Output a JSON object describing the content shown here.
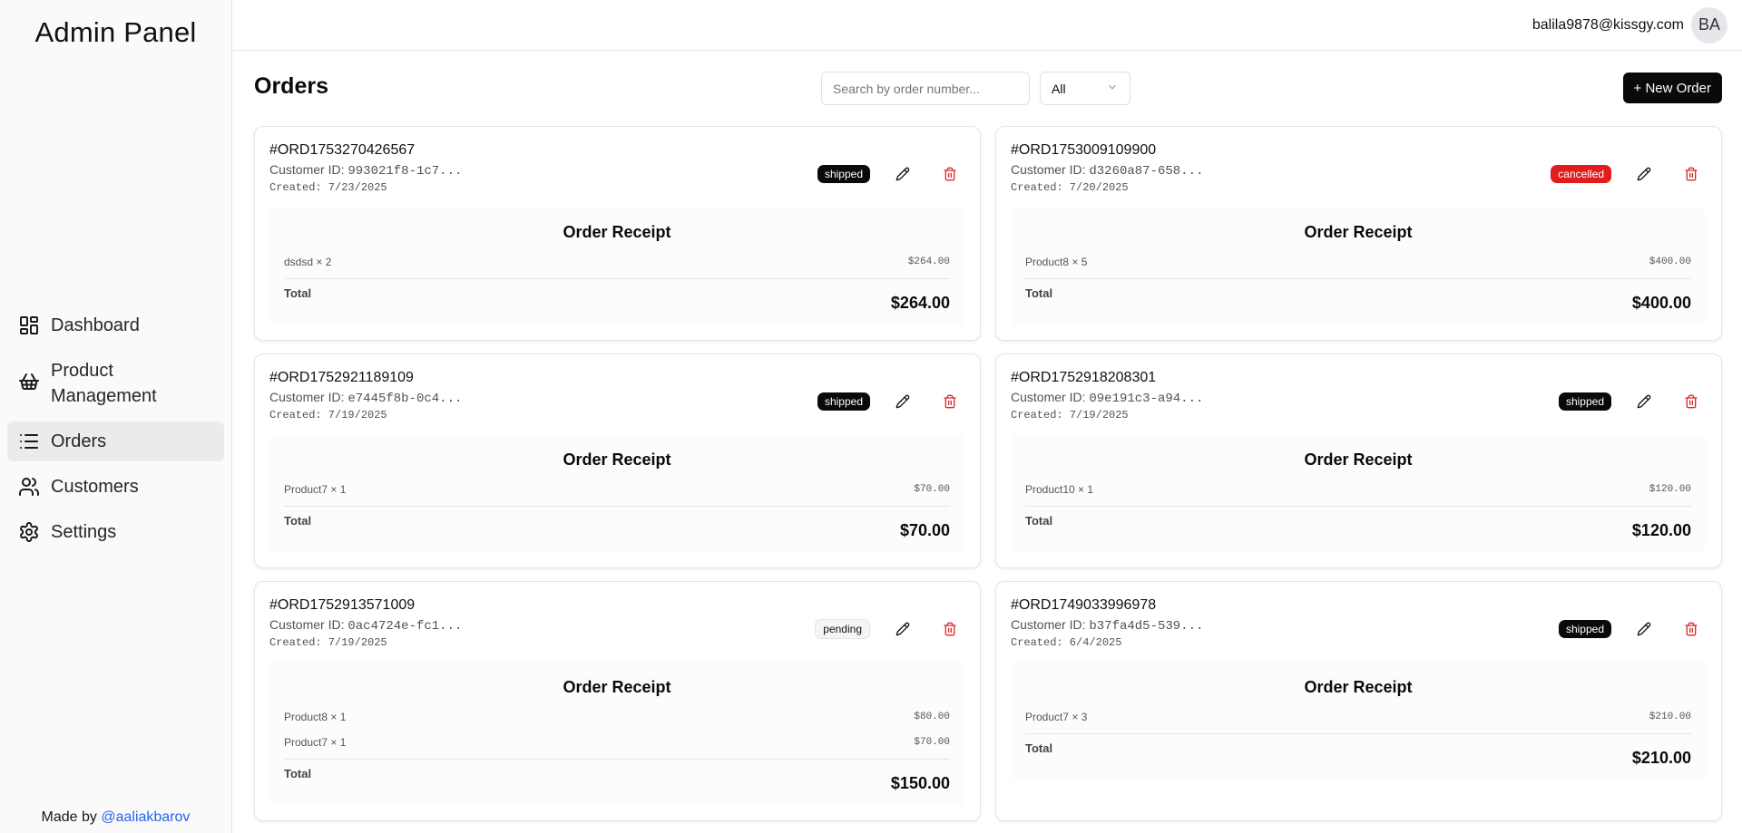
{
  "sidebar": {
    "brand": "Admin Panel",
    "items": [
      {
        "label": "Dashboard",
        "icon": "dashboard-icon"
      },
      {
        "label": "Product Management",
        "icon": "basket-icon"
      },
      {
        "label": "Orders",
        "icon": "list-icon"
      },
      {
        "label": "Customers",
        "icon": "users-icon"
      },
      {
        "label": "Settings",
        "icon": "gear-icon"
      }
    ],
    "footer_prefix": "Made by ",
    "footer_link": "@aaliakbarov"
  },
  "topbar": {
    "email": "balila9878@kissgy.com",
    "avatar_initials": "BA"
  },
  "page": {
    "title": "Orders",
    "search_placeholder": "Search by order number...",
    "filter_value": "All",
    "new_order_label": "+ New Order",
    "receipt_title": "Order Receipt",
    "total_label": "Total"
  },
  "orders": [
    {
      "number": "#ORD1753270426567",
      "customer_label": "Customer ID: ",
      "customer_id": "993021f8-1c7...",
      "created": "Created: 7/23/2025",
      "status": "shipped",
      "items": [
        {
          "name": "dsdsd × 2",
          "price": "$264.00"
        }
      ],
      "total": "$264.00"
    },
    {
      "number": "#ORD1753009109900",
      "customer_label": "Customer ID: ",
      "customer_id": "d3260a87-658...",
      "created": "Created: 7/20/2025",
      "status": "cancelled",
      "items": [
        {
          "name": "Product8 × 5",
          "price": "$400.00"
        }
      ],
      "total": "$400.00"
    },
    {
      "number": "#ORD1752921189109",
      "customer_label": "Customer ID: ",
      "customer_id": "e7445f8b-0c4...",
      "created": "Created: 7/19/2025",
      "status": "shipped",
      "items": [
        {
          "name": "Product7 × 1",
          "price": "$70.00"
        }
      ],
      "total": "$70.00"
    },
    {
      "number": "#ORD1752918208301",
      "customer_label": "Customer ID: ",
      "customer_id": "09e191c3-a94...",
      "created": "Created: 7/19/2025",
      "status": "shipped",
      "items": [
        {
          "name": "Product10 × 1",
          "price": "$120.00"
        }
      ],
      "total": "$120.00"
    },
    {
      "number": "#ORD1752913571009",
      "customer_label": "Customer ID: ",
      "customer_id": "0ac4724e-fc1...",
      "created": "Created: 7/19/2025",
      "status": "pending",
      "items": [
        {
          "name": "Product8 × 1",
          "price": "$80.00"
        },
        {
          "name": "Product7 × 1",
          "price": "$70.00"
        }
      ],
      "total": "$150.00"
    },
    {
      "number": "#ORD1749033996978",
      "customer_label": "Customer ID: ",
      "customer_id": "b37fa4d5-539...",
      "created": "Created: 6/4/2025",
      "status": "shipped",
      "items": [
        {
          "name": "Product7 × 3",
          "price": "$210.00"
        }
      ],
      "total": "$210.00"
    }
  ]
}
